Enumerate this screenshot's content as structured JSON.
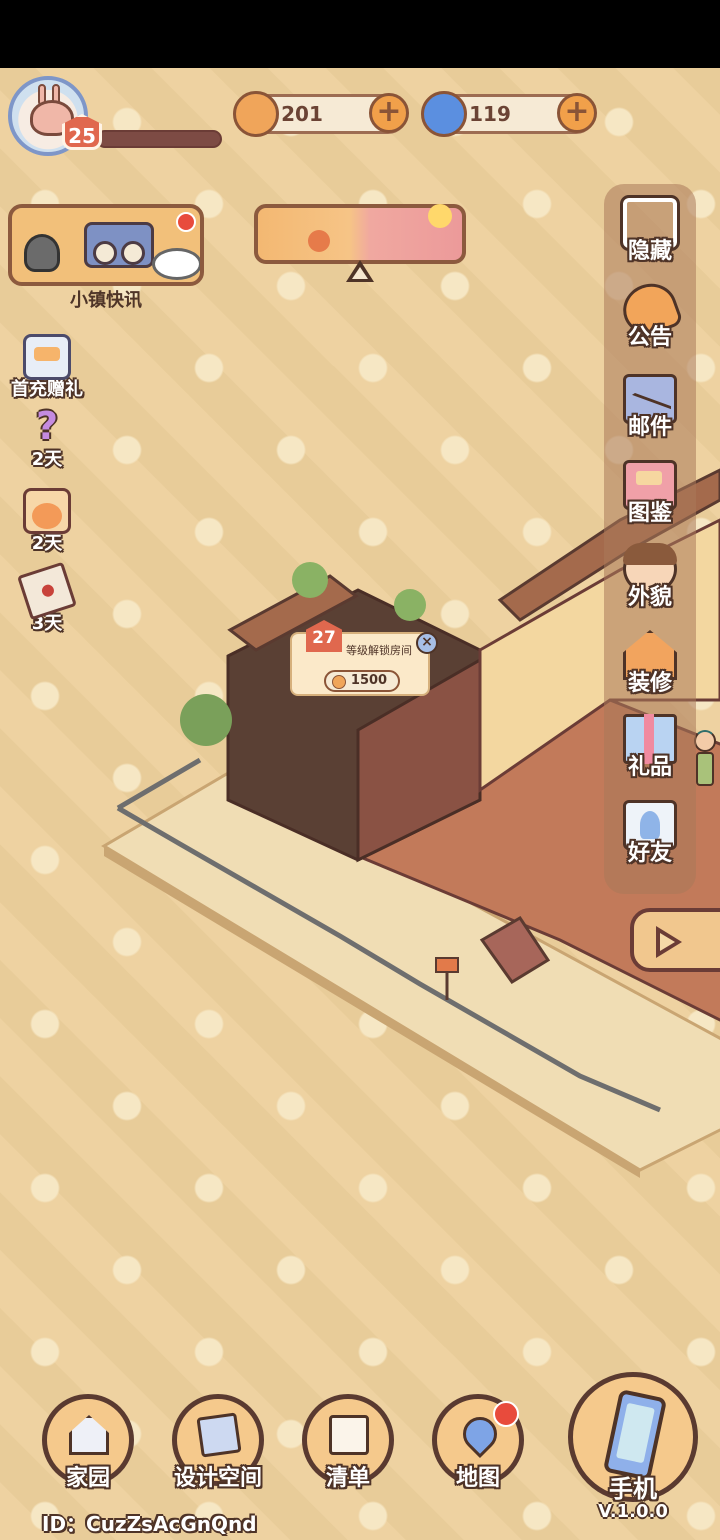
{
  "player": {
    "level": "25",
    "xp_progress": 0.0,
    "id_prefix": "ID：",
    "id": "CuzZsAcGnQnd"
  },
  "currencies": [
    {
      "name": "coin",
      "value": "201",
      "color": "#f0a55a"
    },
    {
      "name": "spiral-gem",
      "value": "119",
      "color": "#5b8fe0"
    }
  ],
  "news": {
    "label": "小镇快讯",
    "has_notification": true
  },
  "events": [
    {
      "label": "首充赠礼",
      "icon": "gift-box-icon"
    },
    {
      "label": "2天",
      "icon": "question-mark-icon"
    },
    {
      "label": "2天",
      "icon": "cat-jar-icon"
    },
    {
      "label": "3天",
      "icon": "sealed-letter-icon"
    }
  ],
  "side_menu": [
    {
      "label": "隐藏",
      "icon": "hide-frame-icon"
    },
    {
      "label": "公告",
      "icon": "megaphone-icon"
    },
    {
      "label": "邮件",
      "icon": "mail-icon"
    },
    {
      "label": "图鉴",
      "icon": "album-icon"
    },
    {
      "label": "外貌",
      "icon": "character-face-icon"
    },
    {
      "label": "装修",
      "icon": "house-wrench-icon"
    },
    {
      "label": "礼品",
      "icon": "present-icon"
    },
    {
      "label": "好友",
      "icon": "friend-card-icon"
    }
  ],
  "room_lock": {
    "level": "27",
    "text": "等级解锁房间",
    "cost": "1500"
  },
  "bottom_nav": [
    {
      "label": "家园",
      "icon": "home-icon",
      "has_notification": false
    },
    {
      "label": "设计空间",
      "icon": "design-ruler-icon",
      "has_notification": false
    },
    {
      "label": "清单",
      "icon": "checklist-icon",
      "has_notification": false
    },
    {
      "label": "地图",
      "icon": "map-pin-icon",
      "has_notification": true
    }
  ],
  "phone": {
    "label": "手机",
    "version": "V.1.0.0"
  },
  "colors": {
    "background": "#edd09c",
    "frame_brown": "#5a3a30",
    "accent_orange": "#f1a04a",
    "notification_red": "#e84b3c"
  }
}
